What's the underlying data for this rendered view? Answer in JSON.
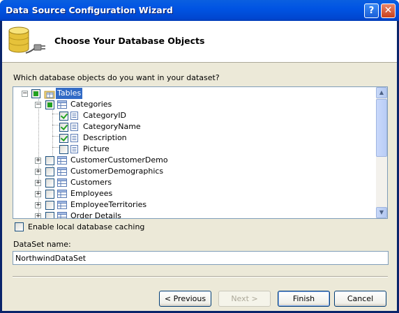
{
  "window": {
    "title": "Data Source Configuration Wizard",
    "help_glyph": "?",
    "close_glyph": "✕"
  },
  "header": {
    "title": "Choose Your Database Objects"
  },
  "prompt": "Which database objects do you want in your dataset?",
  "tree": {
    "root": "Tables",
    "categories": {
      "label": "Categories",
      "columns": [
        {
          "label": "CategoryID",
          "checked": true
        },
        {
          "label": "CategoryName",
          "checked": true
        },
        {
          "label": "Description",
          "checked": true
        },
        {
          "label": "Picture",
          "checked": false
        }
      ]
    },
    "other_tables": [
      "CustomerCustomerDemo",
      "CustomerDemographics",
      "Customers",
      "Employees",
      "EmployeeTerritories",
      "Order Details"
    ]
  },
  "cache": {
    "label": "Enable local database caching",
    "checked": false
  },
  "dataset": {
    "label": "DataSet name:",
    "value": "NorthwindDataSet"
  },
  "buttons": {
    "previous": "< Previous",
    "next": "Next >",
    "finish": "Finish",
    "cancel": "Cancel"
  },
  "colors": {
    "titlebar": "#0054e3",
    "selection": "#316ac5",
    "check": "#21a121"
  }
}
